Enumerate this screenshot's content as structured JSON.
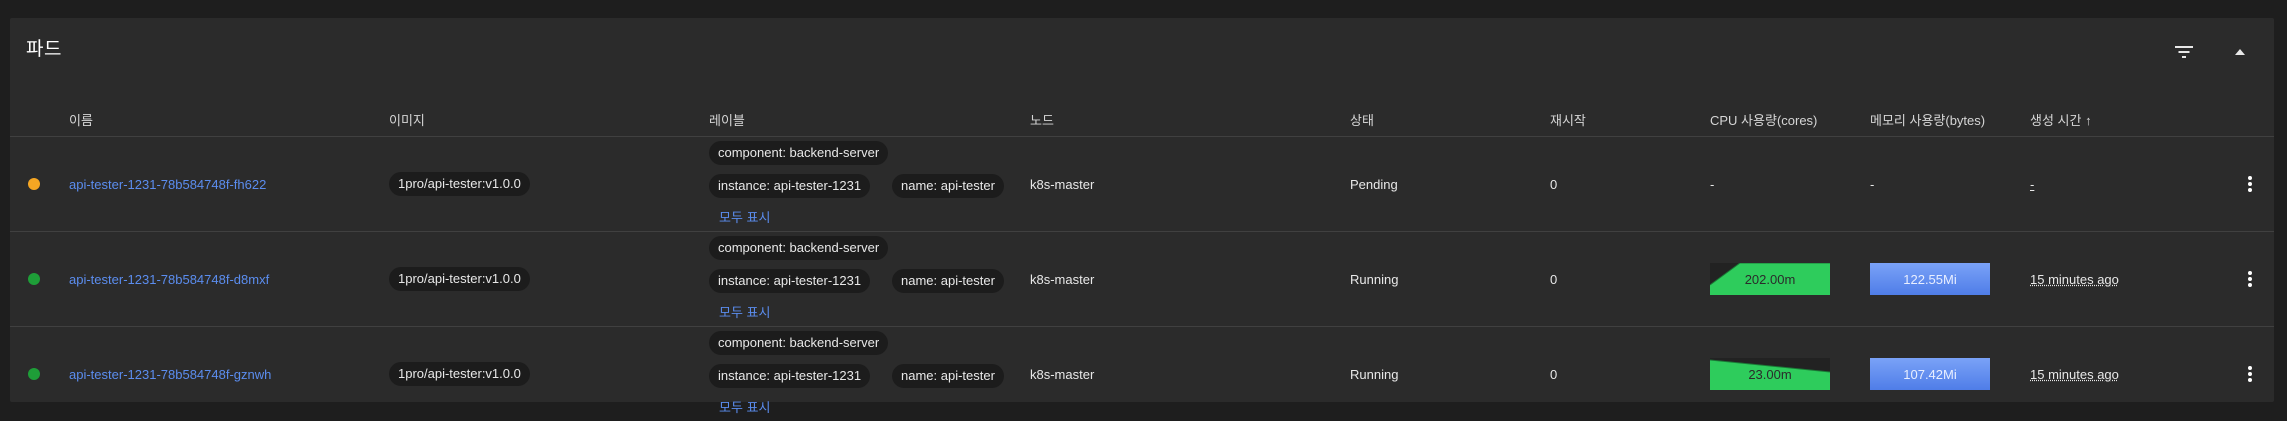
{
  "card": {
    "title": "파드"
  },
  "icons": {
    "filter": "filter-icon",
    "collapse": "chevron-up-icon",
    "sort": "arrow-up-icon",
    "menu": "more-vert-icon"
  },
  "columns": {
    "name": "이름",
    "image": "이미지",
    "labels": "레이블",
    "node": "노드",
    "status": "상태",
    "restarts": "재시작",
    "cpu": "CPU 사용량(cores)",
    "memory": "메모리 사용량(bytes)",
    "created": "생성 시간 ↑"
  },
  "colors": {
    "pending": "#f5a623",
    "running": "#1e9e38",
    "link": "#5b8def",
    "cpu_fill": "#2ecc5c",
    "mem_fill": "#5f8df0"
  },
  "rows": [
    {
      "status_color": "pending",
      "name": "api-tester-1231-78b584748f-fh622",
      "image": "1pro/api-tester:v1.0.0",
      "labels": [
        "component: backend-server",
        "instance: api-tester-1231",
        "name: api-tester"
      ],
      "show_all": "모두 표시",
      "node": "k8s-master",
      "status": "Pending",
      "restarts": "0",
      "cpu": "-",
      "memory": "-",
      "created": "-"
    },
    {
      "status_color": "running",
      "name": "api-tester-1231-78b584748f-d8mxf",
      "image": "1pro/api-tester:v1.0.0",
      "labels": [
        "component: backend-server",
        "instance: api-tester-1231",
        "name: api-tester"
      ],
      "show_all": "모두 표시",
      "node": "k8s-master",
      "status": "Running",
      "restarts": "0",
      "cpu": "202.00m",
      "memory": "122.55Mi",
      "created": "15 minutes ago"
    },
    {
      "status_color": "running",
      "name": "api-tester-1231-78b584748f-gznwh",
      "image": "1pro/api-tester:v1.0.0",
      "labels": [
        "component: backend-server",
        "instance: api-tester-1231",
        "name: api-tester"
      ],
      "show_all": "모두 표시",
      "node": "k8s-master",
      "status": "Running",
      "restarts": "0",
      "cpu": "23.00m",
      "memory": "107.42Mi",
      "created": "15 minutes ago"
    }
  ]
}
